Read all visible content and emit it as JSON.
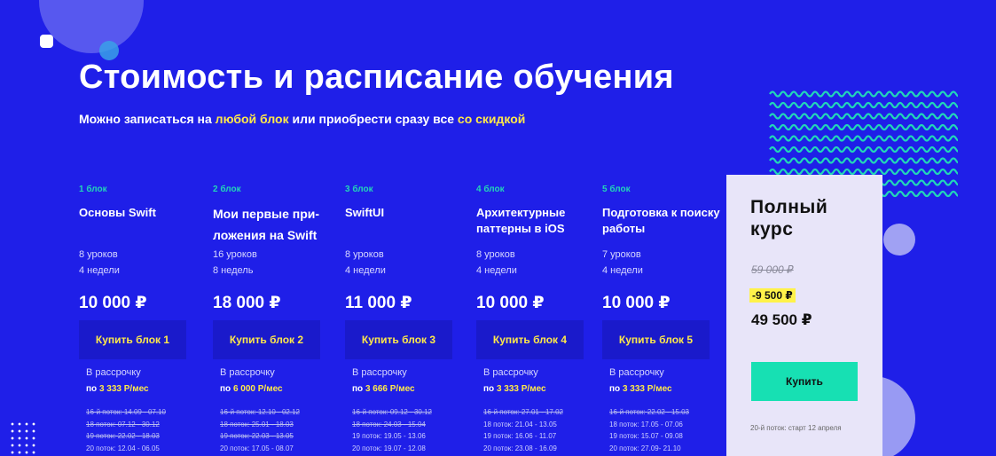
{
  "header": {
    "title": "Стоимость и расписание обучения",
    "subtitle_parts": [
      "Можно записаться на ",
      "любой блок",
      " или приобрести сразу все ",
      "со скидкой"
    ]
  },
  "colors": {
    "background": "#1f1fe8",
    "accent_yellow": "#ffe94a",
    "accent_teal": "#22d6b8",
    "button_dark": "#1a1acb",
    "full_card_bg": "#e8e5f9",
    "full_buy_bg": "#17e0b3"
  },
  "blocks": [
    {
      "num": "1 блок",
      "name": "Основы Swift",
      "lessons": "8 уроков",
      "weeks": "4 недели",
      "price": "10 000 ₽",
      "buy": "Купить блок 1",
      "installment_label": "В рассрочку",
      "installment_prefix": "по ",
      "installment_value": "3 333 Р/мес",
      "streams": [
        {
          "text": "16-й поток: 14.09 - 07.10",
          "old": true
        },
        {
          "text": "18 поток: 07.12 - 30.12",
          "old": true
        },
        {
          "text": "19 поток: 22.02 - 18.03",
          "old": true
        },
        {
          "text": "20 поток: 12.04 - 06.05",
          "old": false
        }
      ]
    },
    {
      "num": "2 блок",
      "name": "Мои первые при-ложения на Swift",
      "lessons": "16 уроков",
      "weeks": "8 недель",
      "price": "18 000 ₽",
      "buy": "Купить блок 2",
      "installment_label": "В рассрочку",
      "installment_prefix": "по ",
      "installment_value": "6 000 Р/мес",
      "streams": [
        {
          "text": "16-й поток: 12.10 - 02.12",
          "old": true
        },
        {
          "text": "18 поток: 25.01 - 18.03",
          "old": true
        },
        {
          "text": "19 поток: 22.03 - 13.05",
          "old": true
        },
        {
          "text": "20 поток: 17.05 - 08.07",
          "old": false
        }
      ]
    },
    {
      "num": "3 блок",
      "name": "SwiftUI",
      "lessons": "8 уроков",
      "weeks": "4 недели",
      "price": "11 000 ₽",
      "buy": "Купить блок 3",
      "installment_label": "В рассрочку",
      "installment_prefix": "по ",
      "installment_value": "3 666 Р/мес",
      "streams": [
        {
          "text": "16-й поток: 09.12 - 30.12",
          "old": true
        },
        {
          "text": "18 поток: 24.03 - 15.04",
          "old": true
        },
        {
          "text": "19 поток: 19.05 - 13.06",
          "old": false
        },
        {
          "text": "20 поток: 19.07 - 12.08",
          "old": false
        }
      ]
    },
    {
      "num": "4 блок",
      "name": "Архитектурные паттерны в iOS",
      "lessons": "8 уроков",
      "weeks": "4 недели",
      "price": "10 000 ₽",
      "buy": "Купить блок 4",
      "installment_label": "В рассрочку",
      "installment_prefix": "по ",
      "installment_value": "3 333 Р/мес",
      "streams": [
        {
          "text": "16-й поток: 27.01 - 17.02",
          "old": true
        },
        {
          "text": "18 поток: 21.04 - 13.05",
          "old": false
        },
        {
          "text": "19 поток: 16.06 - 11.07",
          "old": false
        },
        {
          "text": "20 поток: 23.08 - 16.09",
          "old": false
        }
      ]
    },
    {
      "num": "5 блок",
      "name": "Подготовка к поиску работы",
      "lessons": "7 уроков",
      "weeks": "4 недели",
      "price": "10 000 ₽",
      "buy": "Купить блок 5",
      "installment_label": "В рассрочку",
      "installment_prefix": "по ",
      "installment_value": "3 333 Р/мес",
      "streams": [
        {
          "text": "16-й поток: 22.02 - 15.03",
          "old": true
        },
        {
          "text": "18 поток: 17.05 - 07.06",
          "old": false
        },
        {
          "text": "19 поток: 15.07 - 09.08",
          "old": false
        },
        {
          "text": "20 поток: 27.09- 21.10",
          "old": false
        }
      ]
    }
  ],
  "full_course": {
    "title_line1": "Полный",
    "title_line2": "курс",
    "old_price": "59 000 ₽",
    "discount": "-9 500 ₽",
    "price": "49 500 ₽",
    "buy": "Купить",
    "note": "20-й поток: старт 12 апреля"
  }
}
